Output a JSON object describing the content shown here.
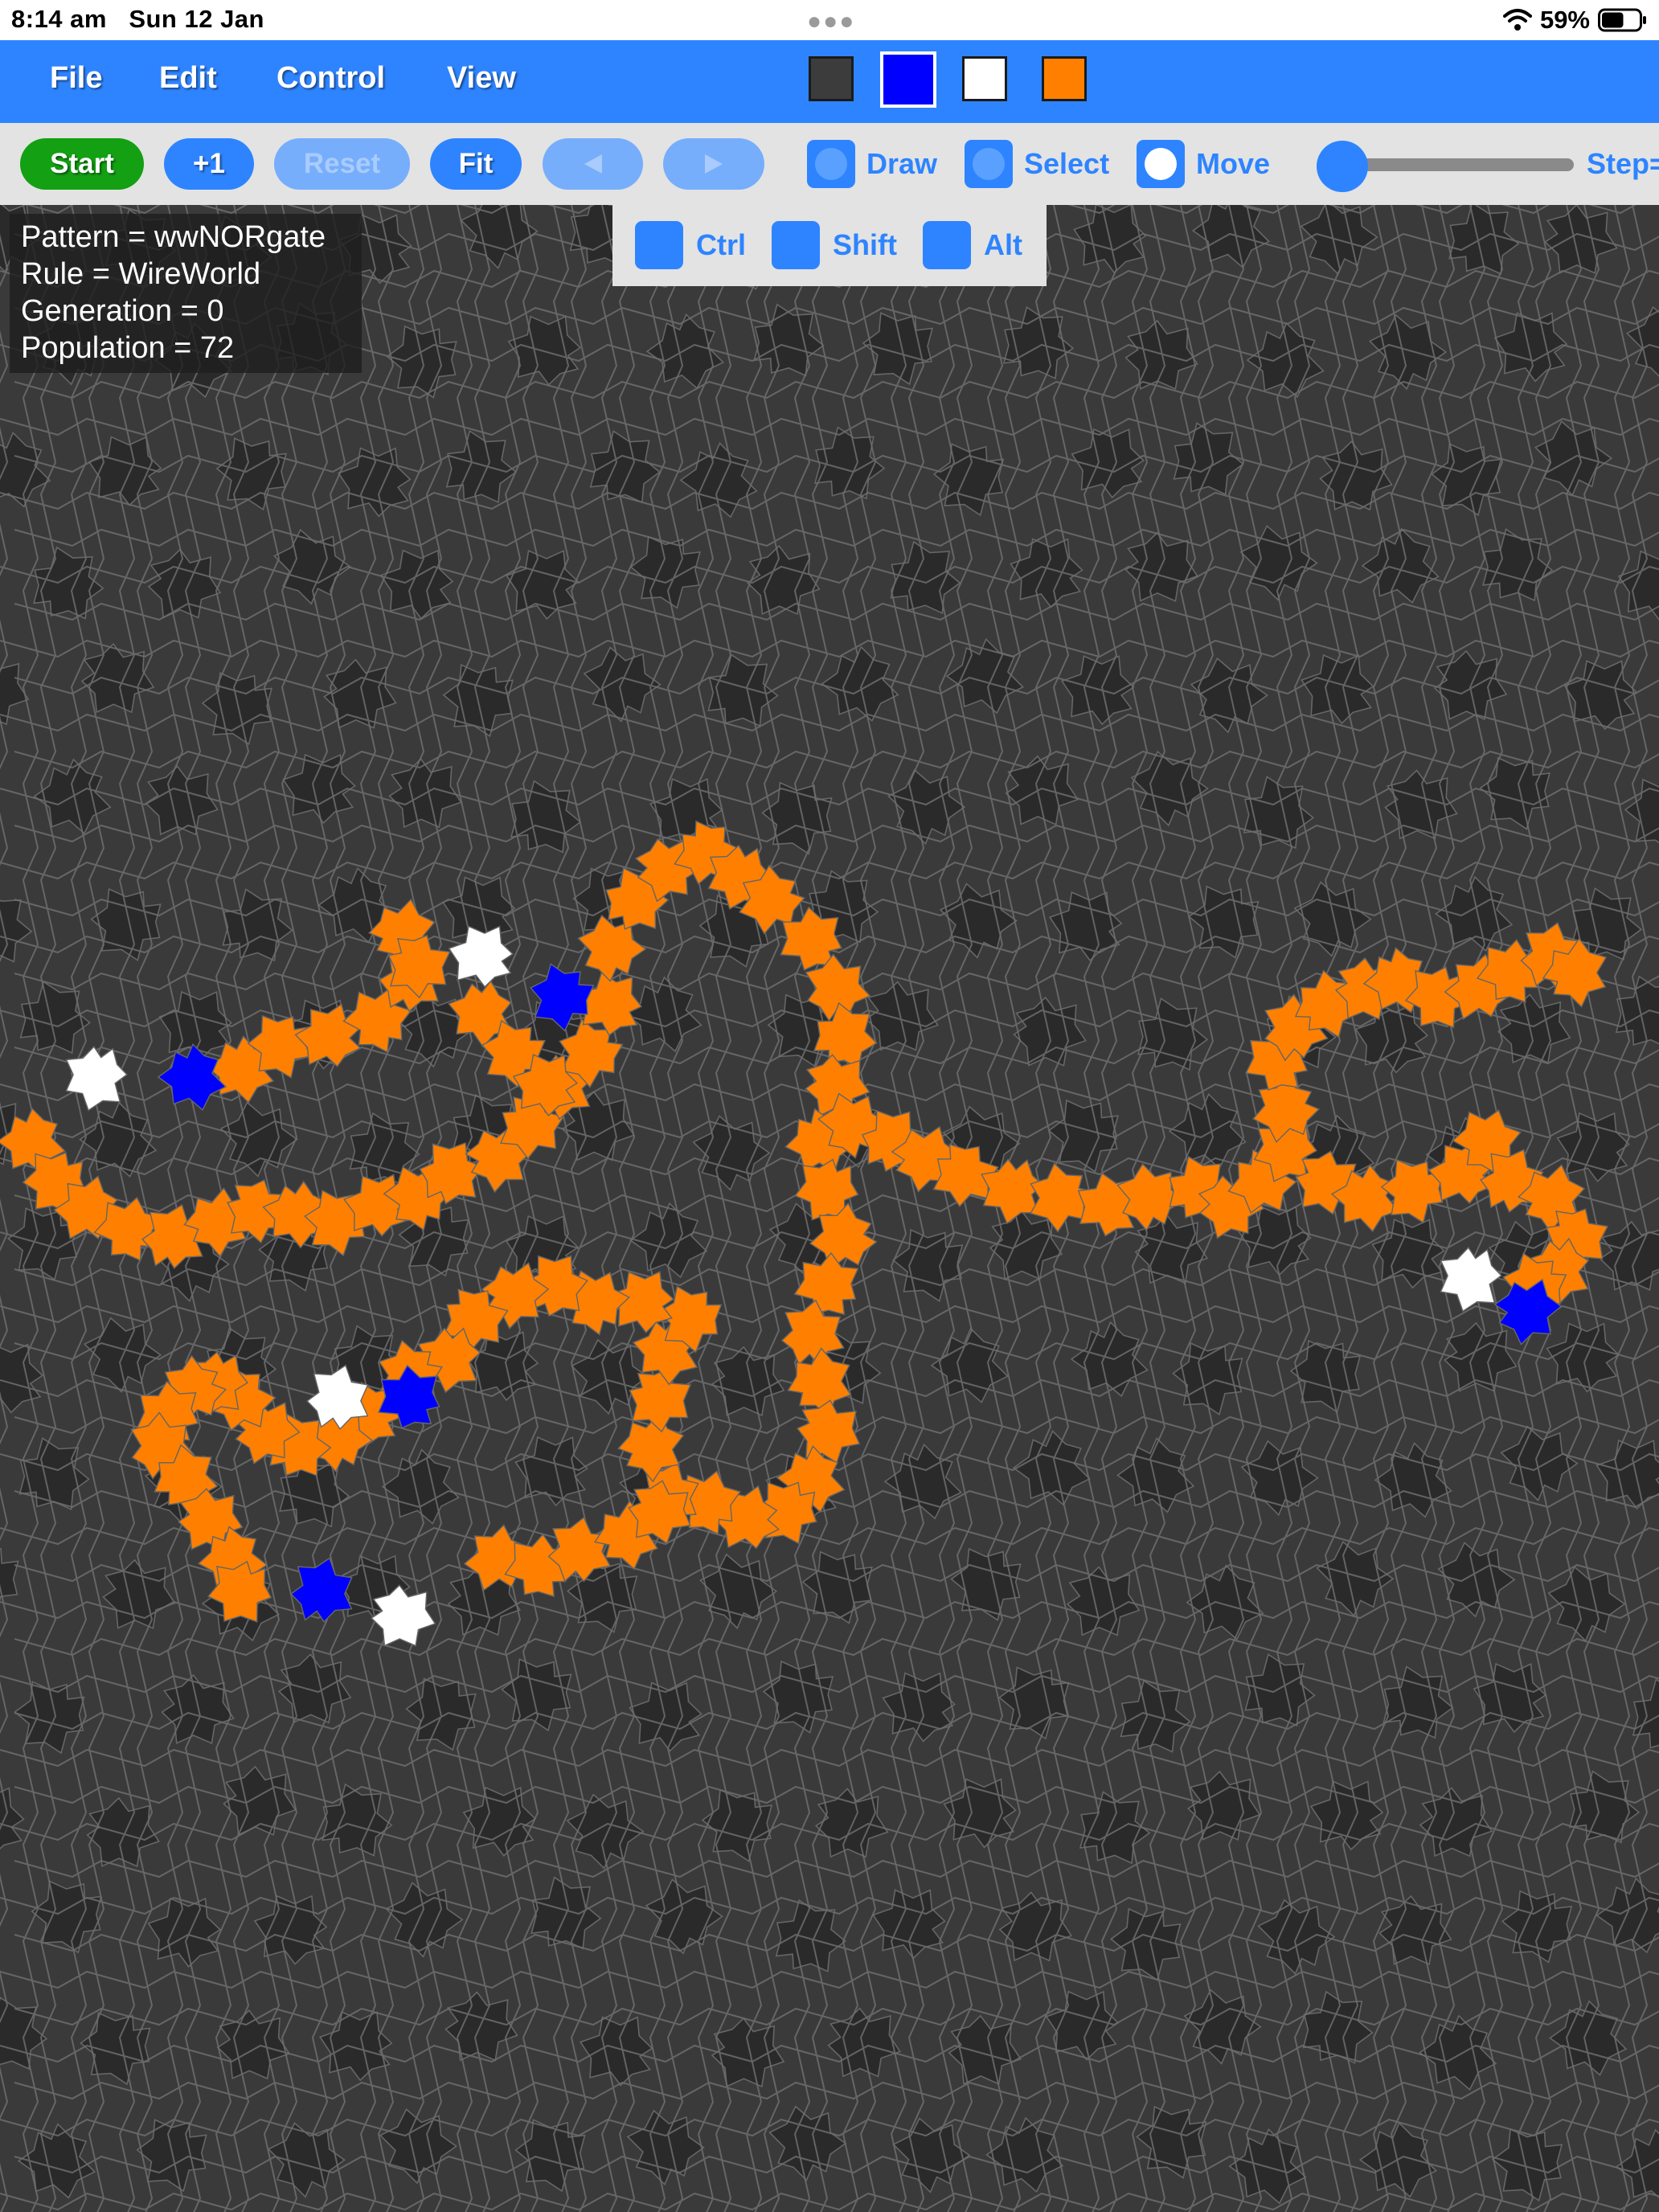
{
  "status_bar": {
    "time": "8:14 am",
    "date": "Sun 12 Jan",
    "battery_percent": "59%",
    "battery_level": 0.59,
    "icons": [
      "multitasking-dots-icon",
      "wifi-icon",
      "battery-icon"
    ]
  },
  "menu": {
    "items": [
      {
        "label": "File"
      },
      {
        "label": "Edit"
      },
      {
        "label": "Control"
      },
      {
        "label": "View"
      }
    ]
  },
  "palette": {
    "selected_index": 1,
    "colors": [
      {
        "name": "state-0-dark",
        "hex": "#3c3c3c"
      },
      {
        "name": "state-1-blue",
        "hex": "#0000ff"
      },
      {
        "name": "state-2-white",
        "hex": "#ffffff"
      },
      {
        "name": "state-3-orange",
        "hex": "#ff8000"
      }
    ]
  },
  "toolbar": {
    "start_label": "Start",
    "step_label": "+1",
    "reset_label": "Reset",
    "fit_label": "Fit",
    "undo_icon": "triangle-left-icon",
    "redo_icon": "triangle-right-icon",
    "modes": [
      {
        "label": "Draw",
        "active": false
      },
      {
        "label": "Select",
        "active": false
      },
      {
        "label": "Move",
        "active": true
      }
    ],
    "step_slider_value": 0,
    "step_text": "Step="
  },
  "modifiers": [
    {
      "label": "Ctrl"
    },
    {
      "label": "Shift"
    },
    {
      "label": "Alt"
    }
  ],
  "info": {
    "pattern": "Pattern = wwNORgate",
    "rule": "Rule = WireWorld",
    "generation": "Generation = 0",
    "population": "Population = 72"
  },
  "colors": {
    "accent": "#2e84ff",
    "start_green": "#13a013",
    "toolbar_bg": "#e3e3e3",
    "cell_empty": "#3c3c3c",
    "cell_dark": "#2a2a2a",
    "wire": "#ff8000",
    "head": "#0000ff",
    "tail": "#ffffff"
  }
}
